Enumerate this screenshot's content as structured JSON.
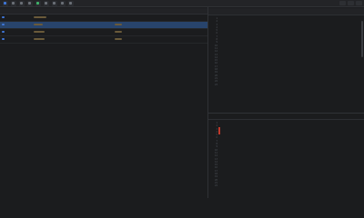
{
  "toolbar": {
    "items": [
      "",
      "",
      "",
      "",
      "",
      "",
      "",
      "",
      ""
    ],
    "title": ""
  },
  "requests": {
    "columns": [
      "",
      "",
      "",
      "",
      "",
      "",
      ""
    ],
    "rows": [
      {
        "id": "",
        "host": "",
        "path": "",
        "method": "",
        "status": "",
        "size": "",
        "time": ""
      },
      {
        "id": "",
        "host": "",
        "path": "",
        "method": "",
        "status": "",
        "size": "",
        "time": ""
      },
      {
        "id": "",
        "host": "",
        "path": "",
        "method": "",
        "status": "",
        "size": "",
        "time": ""
      },
      {
        "id": "",
        "host": "",
        "path": "",
        "method": "",
        "status": "",
        "size": "",
        "time": ""
      }
    ]
  },
  "request_panel": {
    "tabs": [
      "",
      "",
      "",
      "",
      ""
    ],
    "active_tab": 1,
    "lines": [
      "",
      "",
      "",
      "",
      "",
      "",
      "",
      "",
      "",
      "",
      "",
      "",
      "",
      "",
      "",
      "",
      "",
      "",
      "",
      "",
      "",
      "",
      ""
    ]
  },
  "response_panel": {
    "tabs": [
      "",
      "",
      "",
      "",
      ""
    ],
    "active_tab": 0,
    "lines": [
      "",
      "",
      "",
      "",
      "",
      "",
      "",
      "",
      "",
      "",
      "",
      "",
      "",
      "",
      "",
      "",
      "",
      "",
      "",
      "",
      "",
      ""
    ]
  },
  "colors": {
    "accent": "#3f76d8",
    "selected_row": "#28446c",
    "highlight": "#c0392b"
  }
}
